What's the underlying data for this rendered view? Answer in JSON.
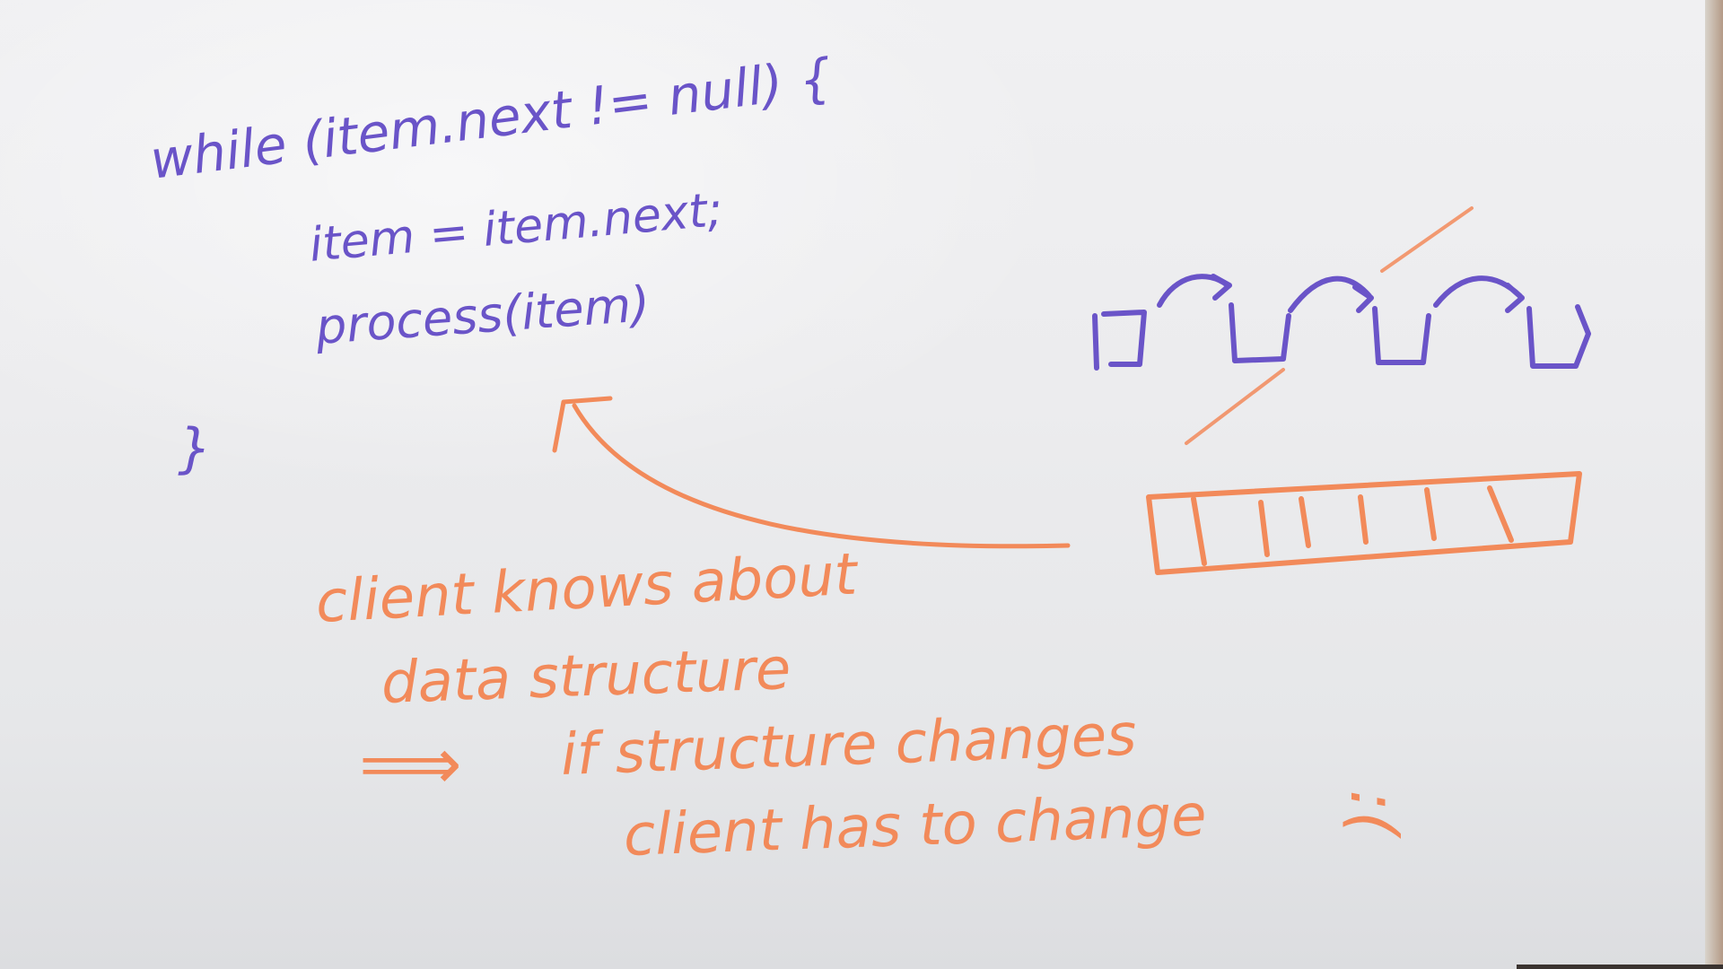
{
  "code": {
    "line1": "while (item.next != null) {",
    "line2": "item = item.next;",
    "line3": "process(item)",
    "line4": "}"
  },
  "notes": {
    "line1": "client knows about",
    "line2": "data structure",
    "arrow": "⟹",
    "line3": "if structure changes",
    "line4": "client has to change",
    "face": ":("
  },
  "colors": {
    "purple_marker": "#6a54c8",
    "orange_marker": "#f28a5a",
    "board": "#ececee"
  }
}
